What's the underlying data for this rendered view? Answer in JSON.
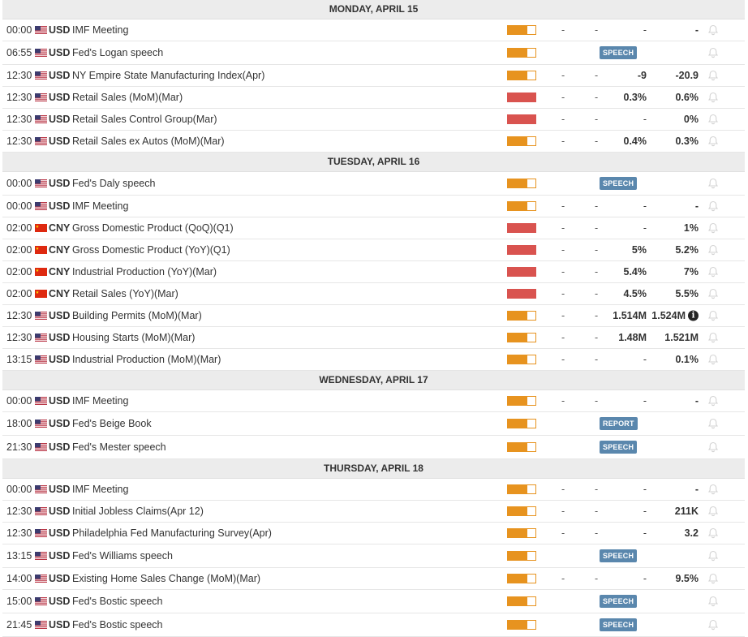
{
  "days": [
    {
      "label": "MONDAY, APRIL 15",
      "rows": [
        {
          "time": "00:00",
          "flag": "us",
          "currency": "USD",
          "event": "IMF Meeting",
          "impact": "medium",
          "c1": "-",
          "c2": "-",
          "actual": "-",
          "previous": "-",
          "h": 27
        },
        {
          "time": "06:55",
          "flag": "us",
          "currency": "USD",
          "event": "Fed's Logan speech",
          "impact": "medium",
          "badge": "SPEECH",
          "h": 29
        },
        {
          "time": "12:30",
          "flag": "us",
          "currency": "USD",
          "event": "NY Empire State Manufacturing Index(Apr)",
          "impact": "medium",
          "c1": "-",
          "c2": "-",
          "actual": "-9",
          "previous": "-20.9",
          "h": 27
        },
        {
          "time": "12:30",
          "flag": "us",
          "currency": "USD",
          "event": "Retail Sales (MoM)(Mar)",
          "impact": "high",
          "c1": "-",
          "c2": "-",
          "actual": "0.3%",
          "previous": "0.6%",
          "h": 27
        },
        {
          "time": "12:30",
          "flag": "us",
          "currency": "USD",
          "event": "Retail Sales Control Group(Mar)",
          "impact": "high",
          "c1": "-",
          "c2": "-",
          "actual": "-",
          "previous": "0%",
          "h": 27
        },
        {
          "time": "12:30",
          "flag": "us",
          "currency": "USD",
          "event": "Retail Sales ex Autos (MoM)(Mar)",
          "impact": "medium",
          "c1": "-",
          "c2": "-",
          "actual": "0.4%",
          "previous": "0.3%",
          "h": 27
        }
      ]
    },
    {
      "label": "TUESDAY, APRIL 16",
      "rows": [
        {
          "time": "00:00",
          "flag": "us",
          "currency": "USD",
          "event": "Fed's Daly speech",
          "impact": "medium",
          "badge": "SPEECH",
          "h": 29
        },
        {
          "time": "00:00",
          "flag": "us",
          "currency": "USD",
          "event": "IMF Meeting",
          "impact": "medium",
          "c1": "-",
          "c2": "-",
          "actual": "-",
          "previous": "-",
          "h": 27
        },
        {
          "time": "02:00",
          "flag": "cn",
          "currency": "CNY",
          "event": "Gross Domestic Product (QoQ)(Q1)",
          "impact": "high",
          "c1": "-",
          "c2": "-",
          "actual": "-",
          "previous": "1%",
          "h": 27
        },
        {
          "time": "02:00",
          "flag": "cn",
          "currency": "CNY",
          "event": "Gross Domestic Product (YoY)(Q1)",
          "impact": "high",
          "c1": "-",
          "c2": "-",
          "actual": "5%",
          "previous": "5.2%",
          "h": 27
        },
        {
          "time": "02:00",
          "flag": "cn",
          "currency": "CNY",
          "event": "Industrial Production (YoY)(Mar)",
          "impact": "high",
          "c1": "-",
          "c2": "-",
          "actual": "5.4%",
          "previous": "7%",
          "h": 27
        },
        {
          "time": "02:00",
          "flag": "cn",
          "currency": "CNY",
          "event": "Retail Sales (YoY)(Mar)",
          "impact": "high",
          "c1": "-",
          "c2": "-",
          "actual": "4.5%",
          "previous": "5.5%",
          "h": 27
        },
        {
          "time": "12:30",
          "flag": "us",
          "currency": "USD",
          "event": "Building Permits (MoM)(Mar)",
          "impact": "medium",
          "c1": "-",
          "c2": "-",
          "actual": "1.514M",
          "previous": "1.524M",
          "info": true,
          "h": 27
        },
        {
          "time": "12:30",
          "flag": "us",
          "currency": "USD",
          "event": "Housing Starts (MoM)(Mar)",
          "impact": "medium",
          "c1": "-",
          "c2": "-",
          "actual": "1.48M",
          "previous": "1.521M",
          "h": 27
        },
        {
          "time": "13:15",
          "flag": "us",
          "currency": "USD",
          "event": "Industrial Production (MoM)(Mar)",
          "impact": "medium",
          "c1": "-",
          "c2": "-",
          "actual": "-",
          "previous": "0.1%",
          "h": 27
        }
      ]
    },
    {
      "label": "WEDNESDAY, APRIL 17",
      "rows": [
        {
          "time": "00:00",
          "flag": "us",
          "currency": "USD",
          "event": "IMF Meeting",
          "impact": "medium",
          "c1": "-",
          "c2": "-",
          "actual": "-",
          "previous": "-",
          "h": 27
        },
        {
          "time": "18:00",
          "flag": "us",
          "currency": "USD",
          "event": "Fed's Beige Book",
          "impact": "medium",
          "badge": "REPORT",
          "h": 29
        },
        {
          "time": "21:30",
          "flag": "us",
          "currency": "USD",
          "event": "Fed's Mester speech",
          "impact": "medium",
          "badge": "SPEECH",
          "h": 29
        }
      ]
    },
    {
      "label": "THURSDAY, APRIL 18",
      "rows": [
        {
          "time": "00:00",
          "flag": "us",
          "currency": "USD",
          "event": "IMF Meeting",
          "impact": "medium",
          "c1": "-",
          "c2": "-",
          "actual": "-",
          "previous": "-",
          "h": 27
        },
        {
          "time": "12:30",
          "flag": "us",
          "currency": "USD",
          "event": "Initial Jobless Claims(Apr 12)",
          "impact": "medium",
          "c1": "-",
          "c2": "-",
          "actual": "-",
          "previous": "211K",
          "h": 27
        },
        {
          "time": "12:30",
          "flag": "us",
          "currency": "USD",
          "event": "Philadelphia Fed Manufacturing Survey(Apr)",
          "impact": "medium",
          "c1": "-",
          "c2": "-",
          "actual": "-",
          "previous": "3.2",
          "h": 27
        },
        {
          "time": "13:15",
          "flag": "us",
          "currency": "USD",
          "event": "Fed's Williams speech",
          "impact": "medium",
          "badge": "SPEECH",
          "h": 29
        },
        {
          "time": "14:00",
          "flag": "us",
          "currency": "USD",
          "event": "Existing Home Sales Change (MoM)(Mar)",
          "impact": "medium",
          "c1": "-",
          "c2": "-",
          "actual": "-",
          "previous": "9.5%",
          "h": 27
        },
        {
          "time": "15:00",
          "flag": "us",
          "currency": "USD",
          "event": "Fed's Bostic speech",
          "impact": "medium",
          "badge": "SPEECH",
          "h": 29
        },
        {
          "time": "21:45",
          "flag": "us",
          "currency": "USD",
          "event": "Fed's Bostic speech",
          "impact": "medium",
          "badge": "SPEECH",
          "h": 29
        }
      ]
    }
  ],
  "colors": {
    "medium": "#e7931f",
    "high": "#d9534f",
    "badge": "#5a87ad",
    "bell": "#d3d3d3"
  },
  "icons": {
    "bell": "bell-icon",
    "info": "info-icon",
    "us_flag": "us-flag-icon",
    "cn_flag": "cn-flag-icon"
  }
}
